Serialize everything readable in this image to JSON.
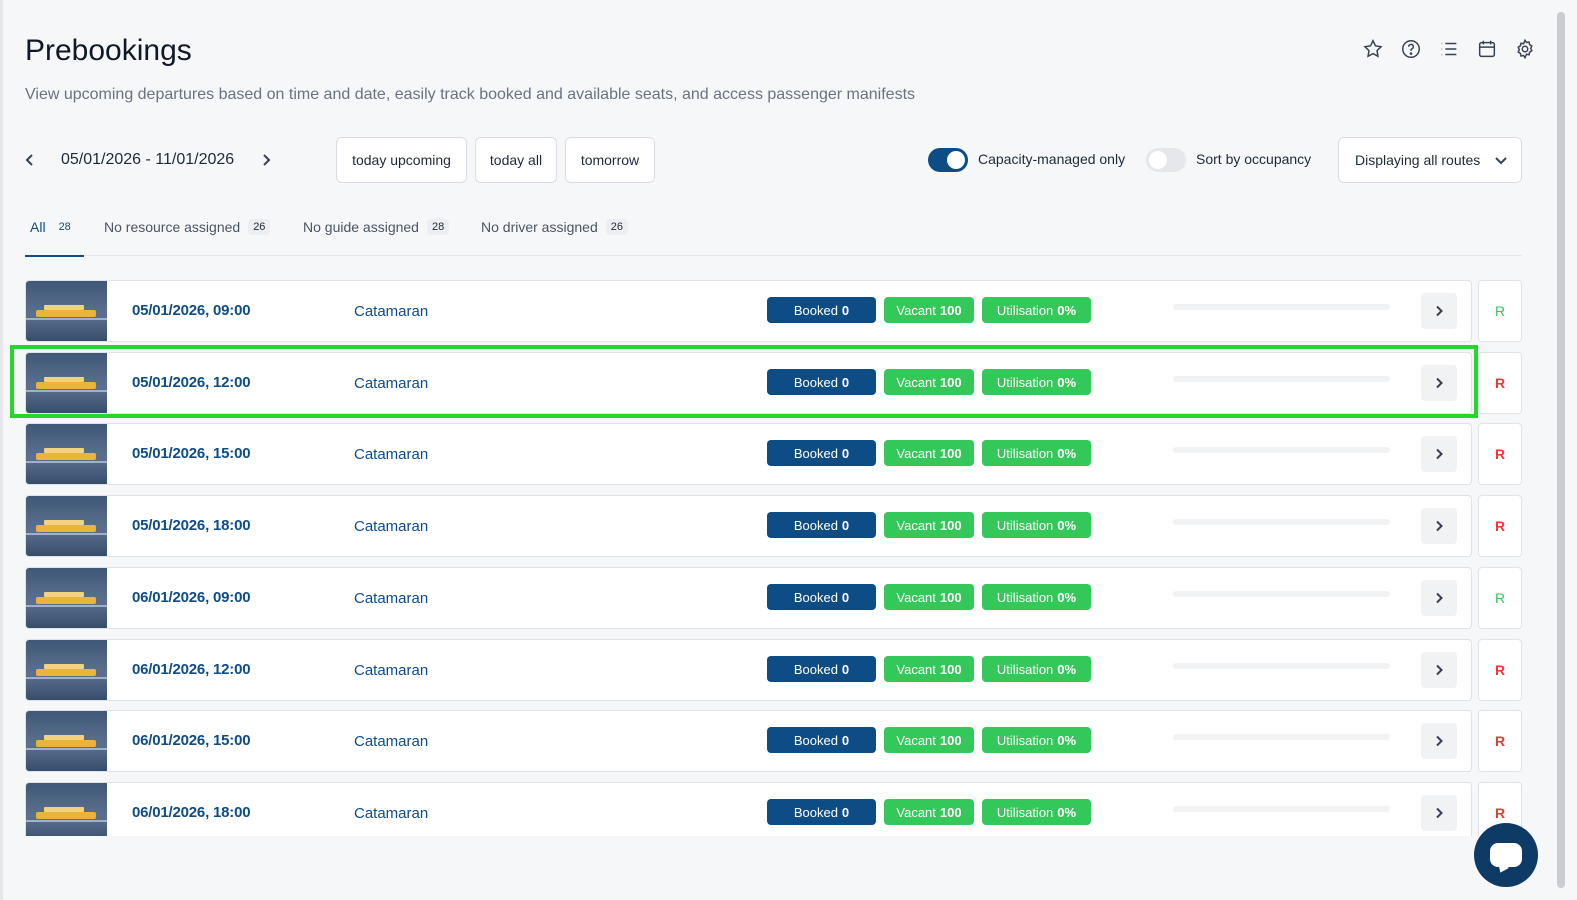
{
  "header": {
    "title": "Prebookings",
    "subtitle": "View upcoming departures based on time and date, easily track booked and available seats, and access passenger manifests",
    "icons": [
      "star-icon",
      "help-icon",
      "list-icon",
      "calendar-icon",
      "settings-icon"
    ]
  },
  "filters": {
    "date_range": "05/01/2026 - 11/01/2026",
    "quick": [
      "today upcoming",
      "today all",
      "tomorrow"
    ],
    "capacity_toggle": {
      "label": "Capacity-managed only",
      "on": true
    },
    "occupancy_toggle": {
      "label": "Sort by occupancy",
      "on": false
    },
    "routes_select": "Displaying all routes"
  },
  "tabs": [
    {
      "label": "All",
      "count": "28",
      "active": true
    },
    {
      "label": "No resource assigned",
      "count": "26",
      "active": false
    },
    {
      "label": "No guide assigned",
      "count": "28",
      "active": false
    },
    {
      "label": "No driver assigned",
      "count": "26",
      "active": false
    }
  ],
  "labels": {
    "booked": "Booked",
    "vacant": "Vacant",
    "utilisation": "Utilisation"
  },
  "departures": [
    {
      "datetime": "05/01/2026, 09:00",
      "route": "Catamaran",
      "booked": "0",
      "vacant": "100",
      "utilisation": "0%",
      "r": "R",
      "r_status": "green"
    },
    {
      "datetime": "05/01/2026, 12:00",
      "route": "Catamaran",
      "booked": "0",
      "vacant": "100",
      "utilisation": "0%",
      "r": "R",
      "r_status": "red"
    },
    {
      "datetime": "05/01/2026, 15:00",
      "route": "Catamaran",
      "booked": "0",
      "vacant": "100",
      "utilisation": "0%",
      "r": "R",
      "r_status": "red"
    },
    {
      "datetime": "05/01/2026, 18:00",
      "route": "Catamaran",
      "booked": "0",
      "vacant": "100",
      "utilisation": "0%",
      "r": "R",
      "r_status": "red"
    },
    {
      "datetime": "06/01/2026, 09:00",
      "route": "Catamaran",
      "booked": "0",
      "vacant": "100",
      "utilisation": "0%",
      "r": "R",
      "r_status": "green"
    },
    {
      "datetime": "06/01/2026, 12:00",
      "route": "Catamaran",
      "booked": "0",
      "vacant": "100",
      "utilisation": "0%",
      "r": "R",
      "r_status": "red"
    },
    {
      "datetime": "06/01/2026, 15:00",
      "route": "Catamaran",
      "booked": "0",
      "vacant": "100",
      "utilisation": "0%",
      "r": "R",
      "r_status": "red"
    },
    {
      "datetime": "06/01/2026, 18:00",
      "route": "Catamaran",
      "booked": "0",
      "vacant": "100",
      "utilisation": "0%",
      "r": "R",
      "r_status": "red"
    }
  ],
  "colors": {
    "primary": "#0e4c86",
    "success": "#34c759",
    "danger": "#e53935",
    "highlight": "#27d62a"
  }
}
